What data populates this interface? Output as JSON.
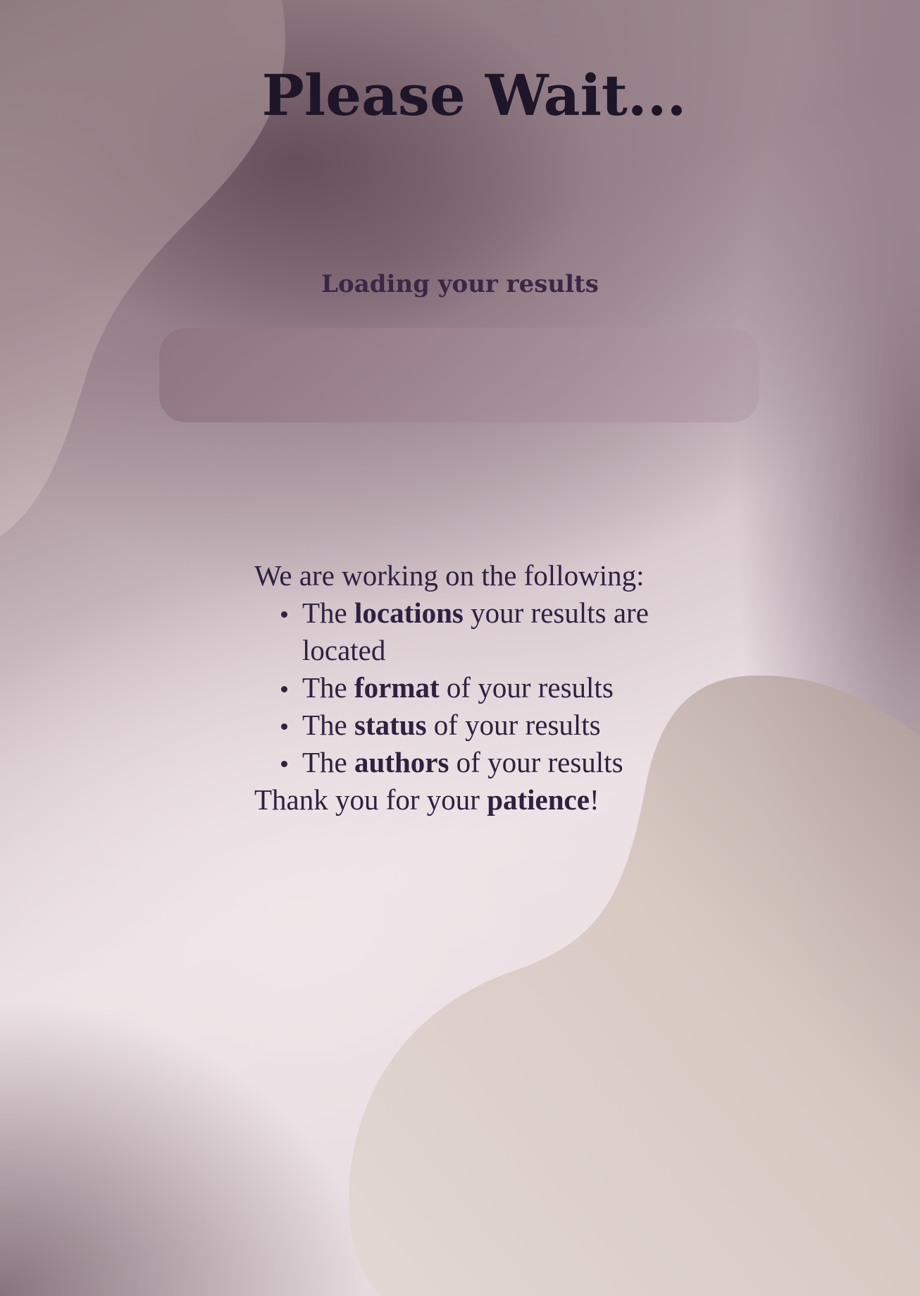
{
  "page": {
    "title": "Please Wait...",
    "loading_label": "Loading your results"
  },
  "progress": {
    "fill_fraction": 0
  },
  "info": {
    "intro": "We are working on the following:",
    "items": [
      {
        "prefix": "The ",
        "bold": "locations",
        "suffix": " your results are located"
      },
      {
        "prefix": "The ",
        "bold": "format",
        "suffix": " of your results"
      },
      {
        "prefix": "The ",
        "bold": "status",
        "suffix": " of your results"
      },
      {
        "prefix": "The ",
        "bold": "authors",
        "suffix": " of your results"
      }
    ],
    "thanks": {
      "prefix": "Thank you for your ",
      "bold": "patience",
      "suffix": "!"
    }
  },
  "colors": {
    "title": "#1d1628",
    "text": "#2f2140",
    "progress_track": "#9c8590",
    "blob_beige": "#dccdc6"
  }
}
